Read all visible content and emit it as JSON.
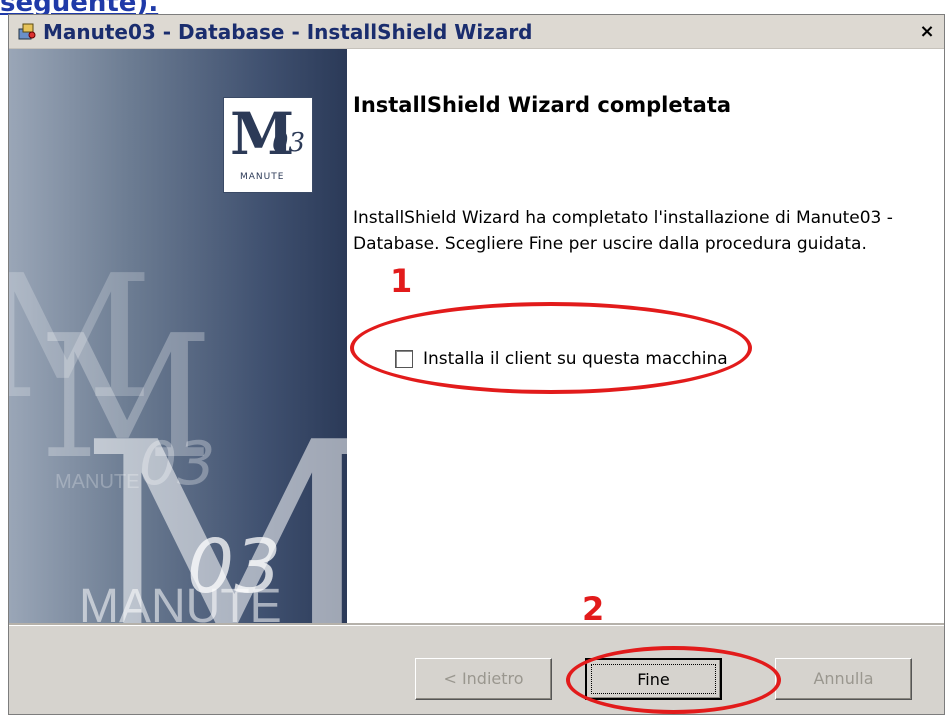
{
  "page": {
    "top_link_text": "seguente)."
  },
  "window": {
    "title": "Manute03 - Database - InstallShield Wizard",
    "close_symbol": "×"
  },
  "sidebar": {
    "logo_letter": "M",
    "logo_number": "03",
    "logo_name": "MANUTE",
    "watermark_letter": "M",
    "watermark_number": "03",
    "watermark_name": "MANUTE"
  },
  "content": {
    "heading": "InstallShield Wizard completata",
    "description": "InstallShield Wizard ha completato l'installazione di Manute03 - Database. Scegliere Fine per uscire dalla procedura guidata.",
    "checkbox_label": "Installa il client su questa macchina",
    "checkbox_checked": false
  },
  "buttons": {
    "back_label": "< Indietro",
    "finish_label": "Fine",
    "cancel_label": "Annulla"
  },
  "annotations": {
    "marker_1": "1",
    "marker_2": "2",
    "color": "#e21b1b"
  },
  "icons": {
    "title_icon": "installer-icon",
    "close_icon": "close-icon"
  }
}
